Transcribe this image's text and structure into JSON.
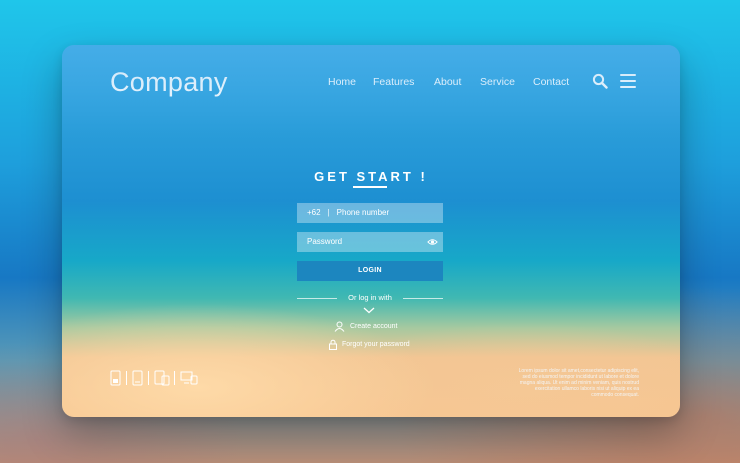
{
  "brand": {
    "logo_text": "Company"
  },
  "nav": {
    "items": [
      "Home",
      "Features",
      "About",
      "Service",
      "Contact"
    ]
  },
  "form": {
    "heading": "GET START !",
    "phone_prefix": "+62",
    "phone_separator": "|",
    "phone_placeholder": "Phone number",
    "password_placeholder": "Password",
    "login_label": "LOGIN",
    "or_text": "Or log in with",
    "create_account": "Create account",
    "forgot_password": "Forgot your password"
  },
  "footer": {
    "lorem_text": "Lorem ipsum dolor sit amet,consectetur adipiscing elit, sed do eiusmod tempor incididunt ut labore et dolore magna aliqua. Ut enim ad minim veniam, quis nostrud exercitation ullamco laboris nisi ut aliquip ex ea commodo consequat."
  },
  "icons": [
    "search-icon",
    "menu-icon",
    "eye-icon",
    "chevron-down-icon",
    "user-icon",
    "lock-icon",
    "mobile-icon",
    "tablet-icon",
    "phone-tablet-icon",
    "desktop-laptop-icon"
  ],
  "colors": {
    "login_button": "#1c86bf",
    "text": "#ffffff"
  }
}
